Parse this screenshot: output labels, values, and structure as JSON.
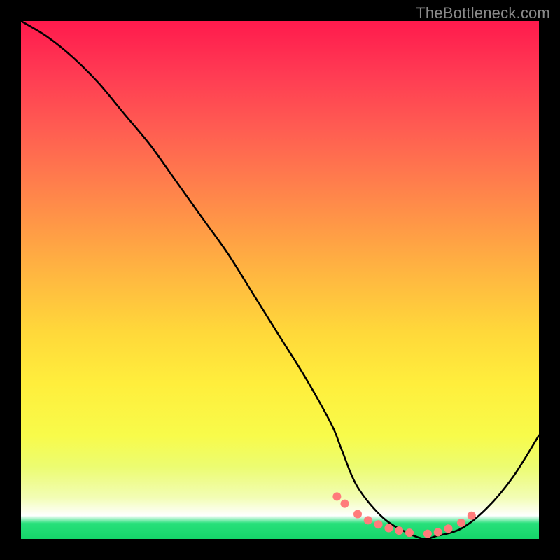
{
  "credit": "TheBottleneck.com",
  "chart_data": {
    "type": "line",
    "title": "",
    "xlabel": "",
    "ylabel": "",
    "xlim": [
      0,
      100
    ],
    "ylim": [
      0,
      100
    ],
    "series": [
      {
        "name": "bottleneck-curve",
        "x": [
          0,
          5,
          10,
          15,
          20,
          25,
          30,
          35,
          40,
          45,
          50,
          55,
          60,
          62,
          65,
          70,
          75,
          78,
          80,
          85,
          90,
          95,
          100
        ],
        "values": [
          100,
          97,
          93,
          88,
          82,
          76,
          69,
          62,
          55,
          47,
          39,
          31,
          22,
          17,
          10,
          4,
          1,
          0,
          0.5,
          2,
          6,
          12,
          20
        ]
      }
    ],
    "markers": {
      "name": "optimal-zone",
      "x": [
        61,
        62.5,
        65,
        67,
        69,
        71,
        73,
        75,
        78.5,
        80.5,
        82.5,
        85,
        87
      ],
      "values": [
        8.2,
        6.8,
        4.8,
        3.6,
        2.8,
        2.1,
        1.6,
        1.2,
        1.0,
        1.3,
        2.0,
        3.1,
        4.5
      ],
      "color": "#ff7b7b",
      "radius_px": 6
    },
    "gradient_stops": [
      {
        "pos": 0.0,
        "color": "#ff1a4d"
      },
      {
        "pos": 0.5,
        "color": "#ffba40"
      },
      {
        "pos": 0.8,
        "color": "#f8fb4a"
      },
      {
        "pos": 0.955,
        "color": "#ffffff"
      },
      {
        "pos": 1.0,
        "color": "#15d56a"
      }
    ]
  }
}
